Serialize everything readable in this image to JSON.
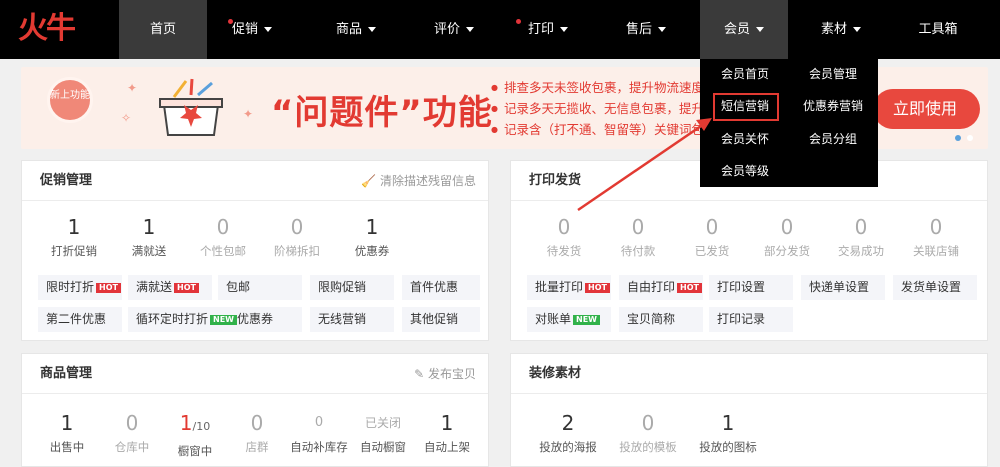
{
  "logo": {
    "text": "火牛"
  },
  "nav": {
    "items": [
      {
        "label": "首页",
        "caret": false,
        "dot": false,
        "active": true
      },
      {
        "label": "促销",
        "caret": true,
        "dot": true,
        "active": false
      },
      {
        "label": "商品",
        "caret": true,
        "dot": false,
        "active": false
      },
      {
        "label": "评价",
        "caret": true,
        "dot": false,
        "active": false
      },
      {
        "label": "打印",
        "caret": true,
        "dot": true,
        "active": false
      },
      {
        "label": "售后",
        "caret": true,
        "dot": false,
        "active": false
      },
      {
        "label": "会员",
        "caret": true,
        "dot": false,
        "active": true
      },
      {
        "label": "素材",
        "caret": true,
        "dot": false,
        "active": false
      },
      {
        "label": "工具箱",
        "caret": false,
        "dot": false,
        "active": false
      }
    ]
  },
  "member_menu": {
    "items": [
      "会员首页",
      "会员管理",
      "短信营销",
      "优惠券营销",
      "会员关怀",
      "会员分组",
      "会员等级"
    ],
    "highlighted": "短信营销"
  },
  "banner": {
    "badge": "新上功能",
    "title": "“问题件”功能",
    "lines": [
      "排查多天未签收包裹，提升物流速度好",
      "记录多天无揽收、无信息包裹，提升用",
      "记录含（打不通、智留等）关键词包裹"
    ],
    "cta": "立即使用"
  },
  "promo_panel": {
    "title": "促销管理",
    "action": "清除描述残留信息",
    "stats": [
      {
        "num": "1",
        "label": "打折促销",
        "muted": false
      },
      {
        "num": "1",
        "label": "满就送",
        "muted": false
      },
      {
        "num": "0",
        "label": "个性包邮",
        "muted": true
      },
      {
        "num": "0",
        "label": "阶梯拆扣",
        "muted": true
      },
      {
        "num": "1",
        "label": "优惠券",
        "muted": false
      }
    ],
    "chips": [
      {
        "label": "限时打折",
        "tag": "HOT"
      },
      {
        "label": "满就送",
        "tag": "HOT"
      },
      {
        "label": "包邮",
        "tag": ""
      },
      {
        "label": "限购促销",
        "tag": ""
      },
      {
        "label": "首件优惠",
        "tag": ""
      },
      {
        "label": "第二件优惠",
        "tag": ""
      },
      {
        "label": "循环定时打折",
        "tag": "NEW"
      },
      {
        "label": "优惠券",
        "tag": ""
      },
      {
        "label": "无线营销",
        "tag": ""
      },
      {
        "label": "其他促销",
        "tag": ""
      }
    ]
  },
  "print_panel": {
    "title": "打印发货",
    "stats": [
      {
        "num": "0",
        "label": "待发货"
      },
      {
        "num": "0",
        "label": "待付款"
      },
      {
        "num": "0",
        "label": "已发货"
      },
      {
        "num": "0",
        "label": "部分发货"
      },
      {
        "num": "0",
        "label": "交易成功"
      },
      {
        "num": "0",
        "label": "关联店铺"
      }
    ],
    "chips": [
      {
        "label": "批量打印",
        "tag": "HOT"
      },
      {
        "label": "自由打印",
        "tag": "HOT"
      },
      {
        "label": "打印设置",
        "tag": ""
      },
      {
        "label": "快递单设置",
        "tag": ""
      },
      {
        "label": "发货单设置",
        "tag": ""
      },
      {
        "label": "对账单",
        "tag": "NEW"
      },
      {
        "label": "宝贝简称",
        "tag": ""
      },
      {
        "label": "打印记录",
        "tag": ""
      }
    ]
  },
  "goods_panel": {
    "title": "商品管理",
    "action": "发布宝贝",
    "stats": [
      {
        "num": "1",
        "label": "出售中",
        "style": "normal",
        "suffix": ""
      },
      {
        "num": "0",
        "label": "仓库中",
        "style": "gray",
        "suffix": ""
      },
      {
        "num": "1",
        "label": "橱窗中",
        "style": "red",
        "suffix": "/10"
      },
      {
        "num": "0",
        "label": "店群",
        "style": "gray",
        "suffix": ""
      },
      {
        "num": "0",
        "label": "自动补库存",
        "style": "gray-small",
        "suffix": ""
      },
      {
        "num": "已关闭",
        "label": "自动橱窗",
        "style": "gray-small",
        "suffix": ""
      },
      {
        "num": "1",
        "label": "自动上架",
        "style": "normal",
        "suffix": ""
      }
    ]
  },
  "decor_panel": {
    "title": "装修素材",
    "stats": [
      {
        "num": "2",
        "label": "投放的海报",
        "muted": false
      },
      {
        "num": "0",
        "label": "投放的模板",
        "muted": true
      },
      {
        "num": "1",
        "label": "投放的图标",
        "muted": false
      }
    ]
  },
  "colors": {
    "accent": "#e23a32",
    "nav_bg": "#000000",
    "banner_bg": "#fcefe9"
  }
}
